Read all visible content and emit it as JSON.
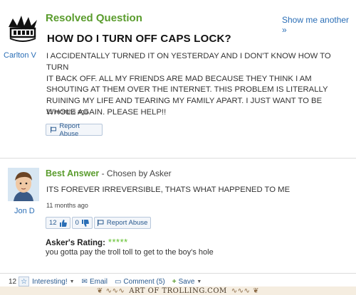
{
  "question": {
    "status": "Resolved Question",
    "show_more": "Show me another »",
    "title": "HOW DO I TURN OFF CAPS LOCK?",
    "body_lines": [
      "I ACCIDENTALLY TURNED IT ON YESTERDAY AND I DON'T KNOW HOW TO TURN",
      "IT BACK OFF. ALL MY FRIENDS ARE MAD BECAUSE THEY THINK I AM",
      "SHOUTING AT THEM OVER THE INTERNET. THIS PROBLEM IS LITERALLY",
      "RUINING MY LIFE AND TEARING MY FAMILY APART. I JUST WANT TO BE",
      "WHOLE AGAIN. PLEASE HELP!!"
    ],
    "time": "11 months ago",
    "report_label": "Report Abuse",
    "user": "Carlton V"
  },
  "answer": {
    "best_label": "Best Answer",
    "chosen_by": " - Chosen by Asker",
    "body": "ITS FOREVER IRREVERSIBLE, THATS WHAT HAPPENED TO ME",
    "time": "11 months ago",
    "thumbs_up": "12",
    "thumbs_down": "0",
    "report_label": "Report Abuse",
    "user": "Jon D",
    "rating_label": "Asker's Rating:",
    "rating_stars": "*****",
    "rating_comment": "you gotta pay the troll toll to get to the boy's hole"
  },
  "bottom_bar": {
    "count": "12",
    "interesting": "Interesting!",
    "email": "Email",
    "comment": "Comment (5)",
    "save": "Save"
  },
  "watermark": {
    "text": "ART OF TROLLING.COM"
  },
  "colors": {
    "green": "#5a9c2d",
    "link_blue": "#2a6eb6",
    "star_green": "#5fbf2a"
  }
}
